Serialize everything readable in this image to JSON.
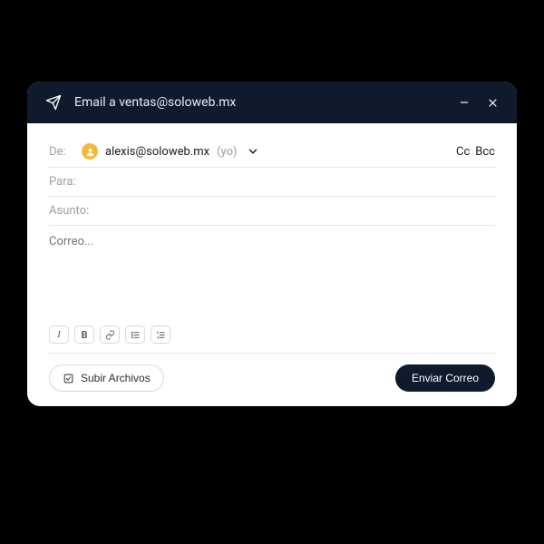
{
  "header": {
    "title": "Email a ventas@soloweb.mx"
  },
  "from": {
    "label": "De:",
    "email": "alexis@soloweb.mx",
    "hint": "(yo)"
  },
  "cc": {
    "cc_label": "Cc",
    "bcc_label": "Bcc"
  },
  "to": {
    "label": "Para:"
  },
  "subject": {
    "label": "Asunto:"
  },
  "message": {
    "placeholder": "Correo..."
  },
  "toolbar": {
    "italic": "I",
    "bold": "B"
  },
  "footer": {
    "upload_label": "Subir Archivos",
    "send_label": "Enviar Correo"
  }
}
